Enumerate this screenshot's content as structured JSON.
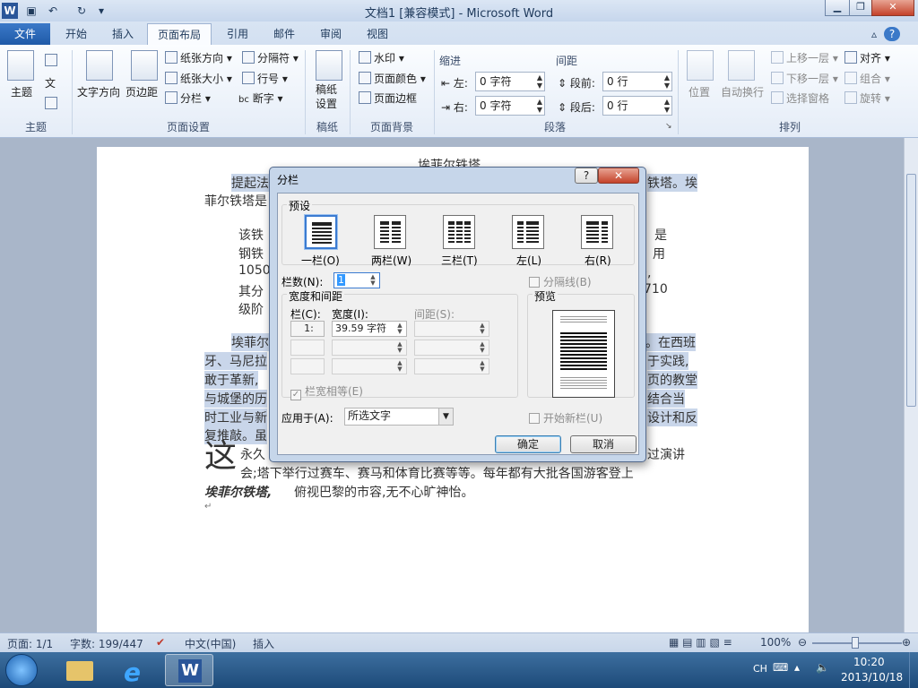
{
  "window": {
    "title": "文档1 [兼容模式] - Microsoft Word",
    "app_icon": "W"
  },
  "tabs": [
    {
      "label": "文件"
    },
    {
      "label": "开始"
    },
    {
      "label": "插入"
    },
    {
      "label": "页面布局"
    },
    {
      "label": "引用"
    },
    {
      "label": "邮件"
    },
    {
      "label": "审阅"
    },
    {
      "label": "视图"
    }
  ],
  "ribbon": {
    "theme": {
      "label": "主题",
      "btn": "主题",
      "colors": "文"
    },
    "page_setup": {
      "label": "页面设置",
      "text_dir": "文字方向",
      "margins": "页边距",
      "orientation": "纸张方向",
      "size": "纸张大小",
      "columns": "分栏",
      "breaks": "分隔符",
      "line_numbers": "行号",
      "hyphen": "断字"
    },
    "manuscript": {
      "label": "稿纸",
      "btn": "稿纸\n设置"
    },
    "background": {
      "label": "页面背景",
      "watermark": "水印",
      "color": "页面颜色",
      "border": "页面边框"
    },
    "paragraph": {
      "label": "段落",
      "indent": "缩进",
      "left": "左:",
      "right": "右:",
      "left_val": "0 字符",
      "right_val": "0 字符",
      "spacing": "间距",
      "before": "段前:",
      "after": "段后:",
      "before_val": "0 行",
      "after_val": "0 行"
    },
    "arrange": {
      "label": "排列",
      "position": "位置",
      "wrap": "自动换行",
      "forward": "上移一层",
      "backward": "下移一层",
      "pane": "选择窗格",
      "align": "对齐",
      "group": "组合",
      "rotate": "旋转"
    }
  },
  "document": {
    "title": "埃菲尔铁塔",
    "lines": [
      "提起法",
      "铁塔。埃",
      "菲尔铁塔是",
      "该铁",
      "是",
      "钢铁",
      "用",
      "1050",
      "多,",
      "其分",
      "710",
      "级阶",
      "埃菲尔",
      "。在西班",
      "牙、马尼拉",
      "于实践,",
      "敢于革新,",
      "页的教堂",
      "与城堡的历",
      "结合当",
      "时工业与新",
      "设计和反",
      "复推敲。虽",
      "永久",
      "过演讲",
      "会;塔下举行过赛车、赛马和体育比赛等等。每年都有大批各国游客登上",
      "俯视巴黎的市容,无不心旷神怡。"
    ],
    "big_char": "这",
    "bold_name": "埃菲尔铁塔,"
  },
  "dialog": {
    "title": "分栏",
    "help": "?",
    "close": "✕",
    "presets_label": "预设",
    "presets": [
      {
        "label": "一栏(O)"
      },
      {
        "label": "两栏(W)"
      },
      {
        "label": "三栏(T)"
      },
      {
        "label": "左(L)"
      },
      {
        "label": "右(R)"
      }
    ],
    "num_cols_label": "栏数(N):",
    "num_cols": "1",
    "separator": "分隔线(B)",
    "width_spacing": "宽度和间距",
    "preview": "预览",
    "col_hdr": "栏(C):",
    "width_hdr": "宽度(I):",
    "spacing_hdr": "间距(S):",
    "row1_col": "1:",
    "row1_width": "39.59 字符",
    "equal_width": "栏宽相等(E)",
    "apply_label": "应用于(A):",
    "apply_val": "所选文字",
    "new_col": "开始新栏(U)",
    "ok": "确定",
    "cancel": "取消"
  },
  "status": {
    "page": "页面: 1/1",
    "words": "字数: 199/447",
    "lang": "中文(中国)",
    "mode": "插入",
    "zoom": "100%"
  },
  "tray": {
    "lang": "CH",
    "time": "10:20",
    "date": "2013/10/18"
  }
}
